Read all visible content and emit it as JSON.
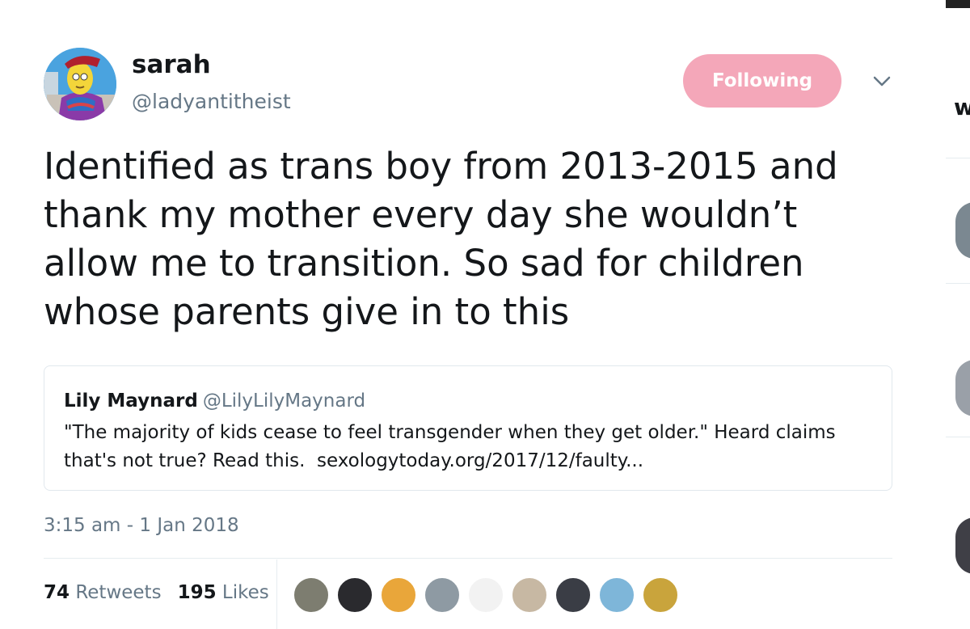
{
  "author": {
    "display_name": "sarah",
    "handle": "@ladyantitheist",
    "avatar_icon": "cartoon-avatar-icon"
  },
  "follow_button": {
    "label": "Following",
    "color": "#f4a7b9"
  },
  "menu": {
    "icon": "chevron-down-icon"
  },
  "tweet": {
    "lines": [
      "Identified as trans boy from 2013-2015 and",
      "thank my mother every day she wouldn’t",
      "allow me to transition. So sad for children",
      "whose parents give in to this"
    ]
  },
  "quoted_tweet": {
    "name": "Lily Maynard",
    "handle": "@LilyLilyMaynard",
    "line1": "\"The majority of kids cease to feel transgender when they get older.\" Heard claims",
    "line2_text": "that's not true? Read this.",
    "link": "sexologytoday.org/2017/12/faulty..."
  },
  "timestamp": "3:15 am - 1 Jan 2018",
  "stats": {
    "retweets_count": "74",
    "retweets_label": "Retweets",
    "likes_count": "195",
    "likes_label": "Likes"
  },
  "likers": [
    {
      "icon": "liker-avatar-icon",
      "color": "#7d7d70"
    },
    {
      "icon": "liker-avatar-icon",
      "color": "#2a2a2e"
    },
    {
      "icon": "liker-avatar-icon",
      "color": "#e9a63a"
    },
    {
      "icon": "liker-avatar-icon",
      "color": "#8e9aa3"
    },
    {
      "icon": "liker-avatar-icon",
      "color": "#f2f2f2"
    },
    {
      "icon": "liker-avatar-icon",
      "color": "#c7b8a3"
    },
    {
      "icon": "liker-avatar-icon",
      "color": "#3a3d45"
    },
    {
      "icon": "liker-avatar-icon",
      "color": "#7eb6d9"
    },
    {
      "icon": "liker-avatar-icon",
      "color": "#c9a43c"
    }
  ],
  "side_panel": {
    "partial_letter": "w"
  }
}
